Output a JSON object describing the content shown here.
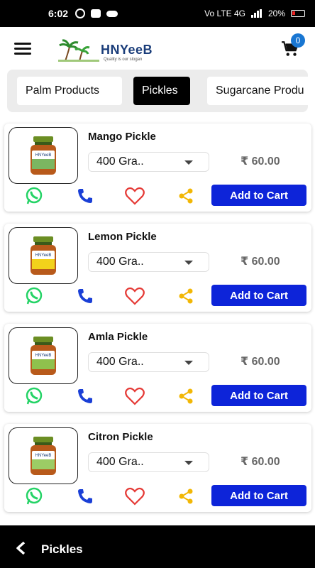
{
  "status_bar": {
    "time": "6:02",
    "network": "Vo LTE 4G",
    "battery": "20%"
  },
  "header": {
    "logo_text": "HNYeeB",
    "logo_tagline": "Quality is our slogan",
    "cart_count": "0"
  },
  "categories": [
    {
      "label": "Palm Products",
      "active": false
    },
    {
      "label": "Pickles",
      "active": true
    },
    {
      "label": "Sugarcane Produ",
      "active": false
    }
  ],
  "products": [
    {
      "name": "Mango Pickle",
      "weight": "400 Gra..",
      "price": "₹ 60.00",
      "add_label": "Add to Cart",
      "label_color": "#7bb661"
    },
    {
      "name": "Lemon Pickle",
      "weight": "400 Gra..",
      "price": "₹ 60.00",
      "add_label": "Add to Cart",
      "label_color": "#f2d21b"
    },
    {
      "name": "Amla Pickle",
      "weight": "400 Gra..",
      "price": "₹ 60.00",
      "add_label": "Add to Cart",
      "label_color": "#8fc14d"
    },
    {
      "name": "Citron Pickle",
      "weight": "400 Gra..",
      "price": "₹ 60.00",
      "add_label": "Add to Cart",
      "label_color": "#9ccc65"
    }
  ],
  "bottom_bar": {
    "title": "Pickles"
  },
  "colors": {
    "primary_button": "#0d24d9",
    "whatsapp": "#25d366",
    "phone": "#1a3fd6",
    "heart": "#e53935",
    "share": "#f2b705",
    "badge": "#1976d2"
  }
}
